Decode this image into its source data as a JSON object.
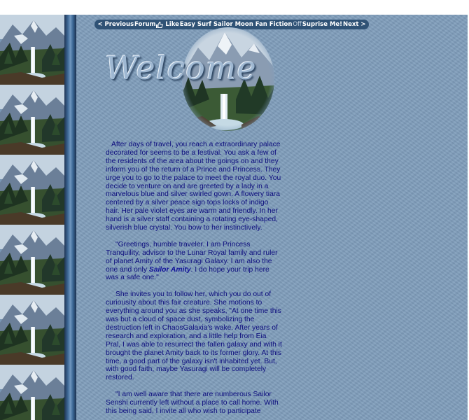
{
  "nav": {
    "previous": "< Previous",
    "forum": "Forum",
    "like": "Like",
    "site": "Easy Surf Sailor Moon Fan Fiction",
    "off": "Off",
    "surprise": "Suprise Me!",
    "next": "Next >"
  },
  "header": {
    "welcome": "Welcome"
  },
  "story": {
    "p1": "After days of travel, you reach a extraordinary palace decorated for seems to be a festival.  You ask a few of the residents of the area about the goings on and they inform you of the return of a Prince and Princess.  They urge you to go to the palace to meet the royal duo.  You decide to venture on and are greeted by a lady in a marvelous blue and silver swirled gown.  A flowery tiara centered by a silver peace sign tops locks of indigo hair.  Her pale violet eyes are warm and friendly.  In her hand is a silver staff containing a rotating eye-shaped, silverish blue crystal.  You bow to her instinctively.",
    "p2_before": "\"Greetings, humble traveler.  I am Princess Tranquility, advisor to the Lunar Royal family and ruler of planet Amity of the Yasuragi Galaxy.  I am also the one and only ",
    "p2_name": "Sailor Amity",
    "p2_after": ".  I do hope your trip here was a safe one.\"",
    "p3": "She invites you to follow her, which you do out of curiousity about this fair creature.  She motions to everything around you as she speaks, \"At one time this was but a cloud of space dust, symbolizing the destruction left in ChaosGalaxia's wake.  After years of research and exploration, and a little help from Eia Pral, I was able to resurrect the fallen galaxy and with it brought the planet Amity back to its former glory.  At this time, a good part of the galaxy isn't inhabited yet.  But, with good faith, maybe Yasuragi will be completely restored.",
    "p4": "\"I am well aware that there are numberous Sailor Senshi currently left without a place to call home.  With this being said, I invite all who wish to participate"
  }
}
